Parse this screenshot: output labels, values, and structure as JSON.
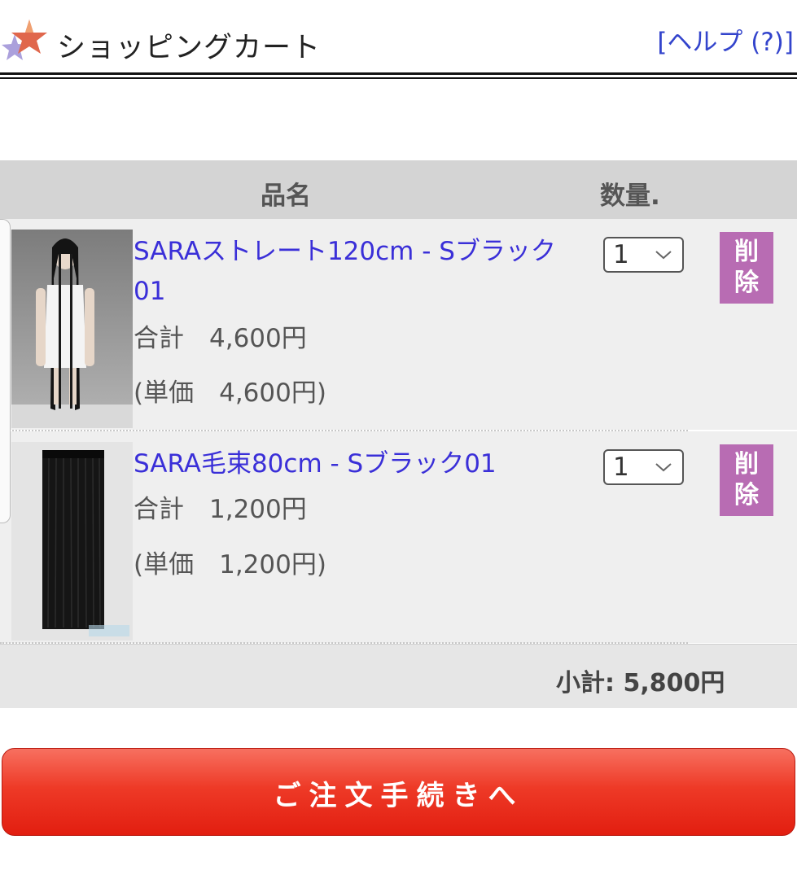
{
  "header": {
    "title": "ショッピングカート",
    "help_label": "[ヘルプ (?)]"
  },
  "table": {
    "col_name": "品名",
    "col_qty": "数量."
  },
  "items": [
    {
      "name": "SARAストレート120cm - Sブラック01",
      "total": "合計　4,600円",
      "unit_price": "(単価　4,600円)",
      "qty": "1",
      "delete_label_1": "削",
      "delete_label_2": "除",
      "image_icon": "long-black-wig-on-mannequin"
    },
    {
      "name": "SARA毛束80cm - Sブラック01",
      "total": "合計　1,200円",
      "unit_price": "(単価　1,200円)",
      "qty": "1",
      "delete_label_1": "削",
      "delete_label_2": "除",
      "image_icon": "black-hair-bundle"
    }
  ],
  "subtotal": "小計: 5,800円",
  "checkout_label": "ご注文手続きへ",
  "colors": {
    "link": "#3a2fd8",
    "delete_bg": "#b86cb3",
    "checkout_bg": "#e21e10",
    "header_bg": "#d4d4d4"
  }
}
